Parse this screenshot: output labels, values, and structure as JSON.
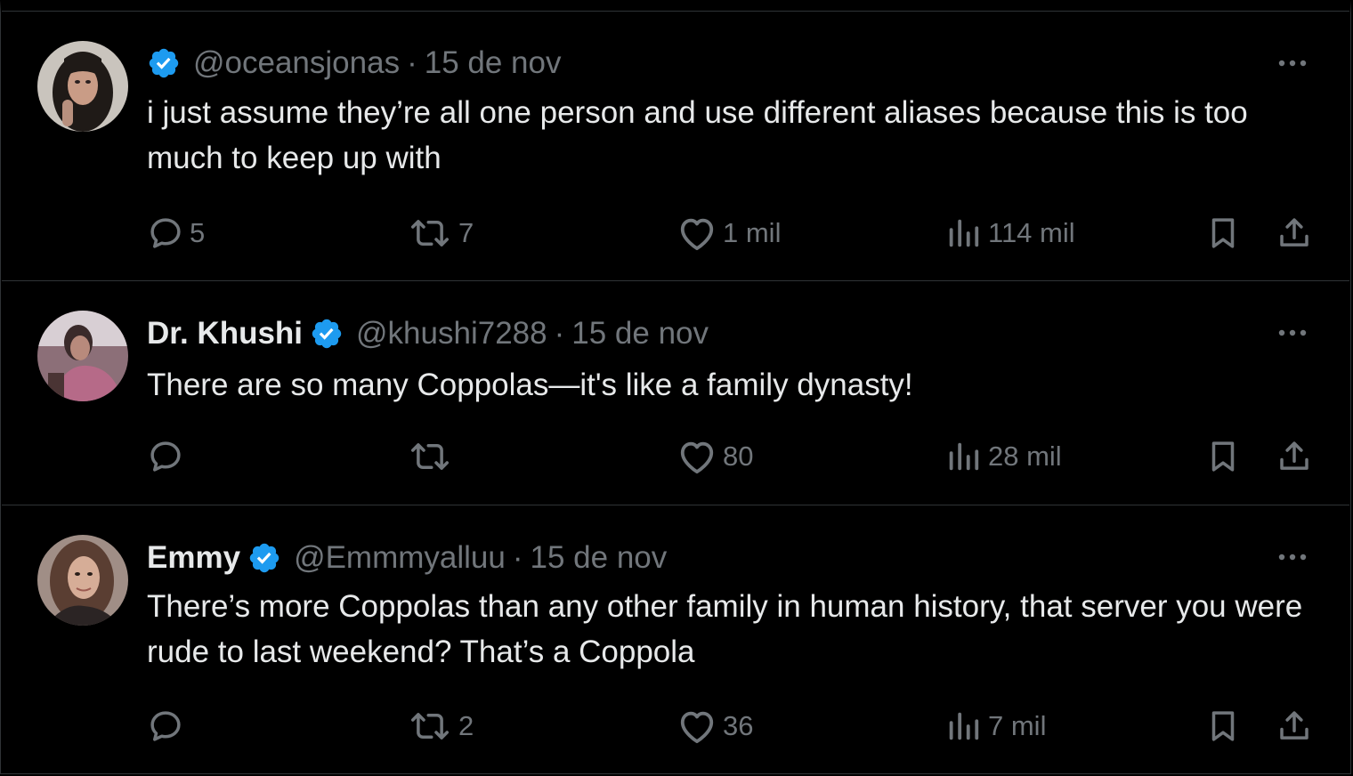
{
  "theme": {
    "background": "#000000",
    "text": "#e7e9ea",
    "muted": "#71767b",
    "divider": "#2f3336",
    "verified": "#1d9bf0"
  },
  "tweets": [
    {
      "name": "",
      "handle": "@oceansjonas",
      "separator": "·",
      "date": "15 de nov",
      "text": "i just assume they’re all one person and use different aliases because this is too much to keep up with",
      "replies": "5",
      "reposts": "7",
      "likes": "1 mil",
      "views": "114 mil",
      "icons": [
        "verified-badge-icon",
        "more-icon",
        "reply-icon",
        "repost-icon",
        "like-icon",
        "views-icon",
        "bookmark-icon",
        "share-icon"
      ]
    },
    {
      "name": "Dr. Khushi",
      "handle": "@khushi7288",
      "separator": "·",
      "date": "15 de nov",
      "text": "There are so many Coppolas—it's like a family dynasty!",
      "replies": "",
      "reposts": "",
      "likes": "80",
      "views": "28 mil",
      "icons": [
        "verified-badge-icon",
        "more-icon",
        "reply-icon",
        "repost-icon",
        "like-icon",
        "views-icon",
        "bookmark-icon",
        "share-icon"
      ]
    },
    {
      "name": "Emmy",
      "handle": "@Emmmyalluu",
      "separator": "·",
      "date": "15 de nov",
      "text": "There’s more Coppolas than any other family in human history, that server you were rude to last weekend? That’s a Coppola",
      "replies": "",
      "reposts": "2",
      "likes": "36",
      "views": "7 mil",
      "icons": [
        "verified-badge-icon",
        "more-icon",
        "reply-icon",
        "repost-icon",
        "like-icon",
        "views-icon",
        "bookmark-icon",
        "share-icon"
      ]
    }
  ]
}
